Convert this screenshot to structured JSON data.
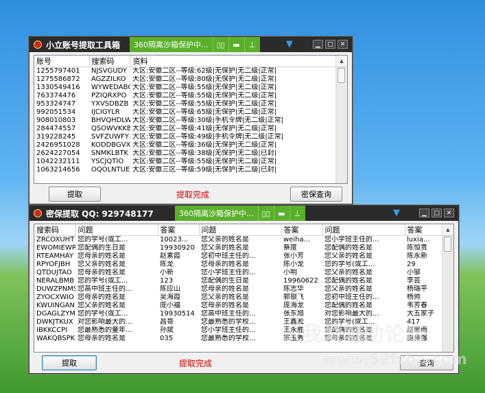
{
  "sandbox": {
    "label": "360隔离沙箱保护中..."
  },
  "window1": {
    "title": "小立账号提取工具箱",
    "columns": [
      "账号",
      "资料",
      "搜索码"
    ],
    "rows": [
      {
        "acct": "1255797401",
        "code": "NJSVGUDY",
        "info": "大区:安徽二区--等级:62级|无保护|无二级|正常|"
      },
      {
        "acct": "1275586872",
        "code": "AGZZILKO",
        "info": "大区:安徽二区--等级:80级|无保护|无二级|正常|"
      },
      {
        "acct": "1330549416",
        "code": "WYWEDABQ",
        "info": "大区:安徽二区--等级:55级|无保护|无二级|正常|"
      },
      {
        "acct": "763374476",
        "code": "PZIQRXPO",
        "info": "大区:安徽二区--等级:55级|无保护|无二级|正常|"
      },
      {
        "acct": "953324747",
        "code": "YXVSDBZB",
        "info": "大区:安徽二区--等级:55级|无保护|无二级|正常|"
      },
      {
        "acct": "992051534",
        "code": "IJCIGYLR",
        "info": "大区:安徽二区--等级:65级|无保护|无二级|正常|"
      },
      {
        "acct": "908010803",
        "code": "BHVQHDLW",
        "info": "大区:安徽二区--等级:30级|手机令牌|无二级|正常|"
      },
      {
        "acct": "284474557",
        "code": "QSOWVKKB",
        "info": "大区:安徽二区--等级:41级|无保护|无二级|正常|"
      },
      {
        "acct": "319228245",
        "code": "SVFZUWFY",
        "info": "大区:安徽二区--等级:49级|手机令牌|无二级|正常|"
      },
      {
        "acct": "2426951028",
        "code": "KODDBGVX",
        "info": "大区:安徽二区--等级:36级|无保护|无二级|正常|"
      },
      {
        "acct": "2624227054",
        "code": "SNMKLBTK",
        "info": "大区:安徽二区--等级:38级|无保护|无二级|已封|"
      },
      {
        "acct": "1042232111",
        "code": "YSCJQTIO",
        "info": "大区:安徽二区--等级:55级|无保护|无二级|正常|"
      },
      {
        "acct": "1063214656",
        "code": "OQOLNTUE",
        "info": "大区:安徽三区--等级:59级|无保护|无二级|已封|"
      }
    ],
    "extract_button": "提取",
    "status": "提取完成",
    "query_button": "密保查询"
  },
  "window2": {
    "title": "密保提取 QQ: 929748177",
    "columns": [
      "搜索码",
      "问题",
      "答案",
      "问题",
      "答案",
      "问题",
      "答案"
    ],
    "rows": [
      [
        "ZRCOXUHT",
        "您的学号(或工...",
        "10023...",
        "您父亲的姓名是",
        "weiha...",
        "您小学班主任的...",
        "luxia..."
      ],
      [
        "EWOMIEWR",
        "您配偶的生日是",
        "19930920",
        "您父亲的姓名是",
        "蔡度",
        "您配偶的姓名是",
        "陈恒贵"
      ],
      [
        "RTEAMHAY",
        "您母亲的姓名是",
        "赵素霞",
        "您初中班主任的...",
        "张小芳",
        "您父亲的姓名是",
        "陈永新"
      ],
      [
        "RPYOFJBH",
        "您父亲的姓名是",
        "陈龙",
        "您母亲的姓名是",
        "陈小龙",
        "您的学号(或工...",
        "29"
      ],
      [
        "QTDUJTAO",
        "您母亲的姓名是",
        "小新",
        "您小学班主任的...",
        "小明",
        "您父亲的姓名是",
        "小邹"
      ],
      [
        "NERALBMB",
        "您的学号(或工...",
        "123",
        "您配偶的生日是",
        "19960622",
        "您配偶的姓名是",
        "李芸"
      ],
      [
        "DUWZPNMS",
        "您高中班主任的...",
        "陈应山",
        "您母亲的姓名是",
        "陈志华",
        "您父亲的姓名是",
        "杨瑞平"
      ],
      [
        "ZYOCXWIO",
        "您母亲的姓名是",
        "吴海霞",
        "您父亲的姓名是",
        "郭银飞",
        "您初中班主任的...",
        "杨帅"
      ],
      [
        "KWUINGAN",
        "您父亲的姓名是",
        "庞小福",
        "您母亲的姓名是",
        "庞海龙",
        "您配偶的姓名是",
        "韦芳春"
      ],
      [
        "DGAGLZYM",
        "您的学号(或工...",
        "19930514",
        "您高中班主任的...",
        "张东旭",
        "对您影响最大的...",
        "大五家子"
      ],
      [
        "DWKJTKUX",
        "对您影响最大的...",
        "昌哥",
        "您最熟悉的学校...",
        "王鑫淞",
        "您的学号(或工...",
        "417"
      ],
      [
        "IBKKCCPI",
        "您最熟悉的童年...",
        "孙斌",
        "您小学班主任的...",
        "王永胜",
        "您配偶的姓名是",
        "赵思雨"
      ],
      [
        "WAKQBSPK",
        "您母亲的姓名是",
        "035",
        "您最熟悉的学校...",
        "宗玉秀",
        "您母亲的姓名是",
        "施良强"
      ]
    ],
    "extract_button": "提取",
    "status": "提取完成",
    "query_button": "查询"
  },
  "watermark": {
    "text1": "我爱辅助论坛",
    "text2": "www.52fzba.com"
  },
  "colors": {
    "sandbox_green": "#5ab02c",
    "titlebar": "#2b2b2b",
    "status_red": "#d40000"
  }
}
